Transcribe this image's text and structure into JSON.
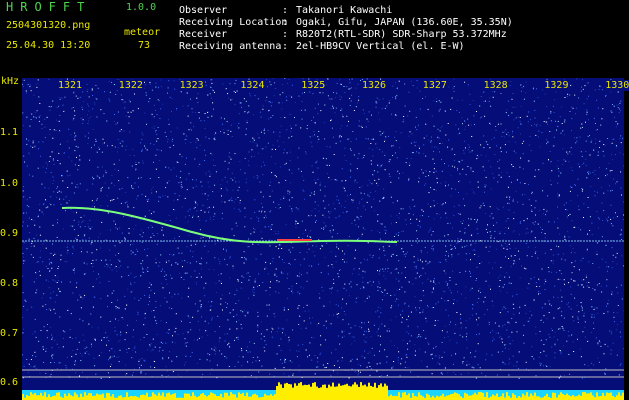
{
  "app": {
    "title": "HROFFT",
    "version": "1.0.0"
  },
  "file": {
    "name": "2504301320.png",
    "datetime": "25.04.30 13:20"
  },
  "meteor": {
    "label": "meteor",
    "count": "73"
  },
  "info": [
    {
      "key": "Observer",
      "value": "Takanori Kawachi"
    },
    {
      "key": "Receiving Location",
      "value": "Ogaki, Gifu, JAPAN (136.60E, 35.35N)"
    },
    {
      "key": "Receiver",
      "value": "R820T2(RTL-SDR) SDR-Sharp 53.372MHz"
    },
    {
      "key": "Receiving antenna",
      "value": "2el-HB9CV Vertical (el. E-W)"
    }
  ],
  "colon": ":",
  "axis": {
    "unit": "kHz",
    "y_ticks": [
      "1.1",
      "1.0",
      "0.9",
      "0.8",
      "0.7",
      "0.6"
    ],
    "x_ticks": [
      "1321",
      "1322",
      "1323",
      "1324",
      "1325",
      "1326",
      "1327",
      "1328",
      "1329",
      "1330"
    ]
  },
  "colors": {
    "background": "#050d78",
    "label": "#e8e800",
    "green": "#4fd34f",
    "meteor": "#7cff7c",
    "carrier": "#9fe6ff",
    "bar": "#ffee00"
  }
}
